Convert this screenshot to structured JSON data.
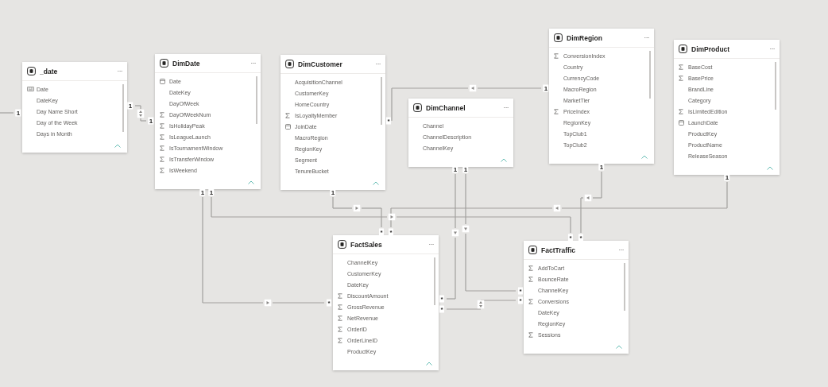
{
  "tables": [
    {
      "name": "_date",
      "scrollable": true,
      "fields": [
        {
          "name": "Date",
          "kind": "hierarchy"
        },
        {
          "name": "DateKey",
          "kind": "plain"
        },
        {
          "name": "Day Name Short",
          "kind": "plain"
        },
        {
          "name": "Day of the Week",
          "kind": "plain"
        },
        {
          "name": "Days in Month",
          "kind": "plain"
        }
      ]
    },
    {
      "name": "DimDate",
      "scrollable": true,
      "fields": [
        {
          "name": "Date",
          "kind": "date"
        },
        {
          "name": "DateKey",
          "kind": "plain"
        },
        {
          "name": "DayOfWeek",
          "kind": "plain"
        },
        {
          "name": "DayOfWeekNum",
          "kind": "sum"
        },
        {
          "name": "IsHolidayPeak",
          "kind": "sum"
        },
        {
          "name": "IsLeagueLaunch",
          "kind": "sum"
        },
        {
          "name": "IsTournamentWindow",
          "kind": "sum"
        },
        {
          "name": "IsTransferWindow",
          "kind": "sum"
        },
        {
          "name": "IsWeekend",
          "kind": "sum"
        }
      ]
    },
    {
      "name": "DimCustomer",
      "scrollable": true,
      "fields": [
        {
          "name": "AcquisitionChannel",
          "kind": "plain"
        },
        {
          "name": "CustomerKey",
          "kind": "plain"
        },
        {
          "name": "HomeCountry",
          "kind": "plain"
        },
        {
          "name": "IsLoyaltyMember",
          "kind": "sum"
        },
        {
          "name": "JoinDate",
          "kind": "date"
        },
        {
          "name": "MacroRegion",
          "kind": "plain"
        },
        {
          "name": "RegionKey",
          "kind": "plain"
        },
        {
          "name": "Segment",
          "kind": "plain"
        },
        {
          "name": "TenureBucket",
          "kind": "plain"
        }
      ]
    },
    {
      "name": "DimChannel",
      "scrollable": false,
      "fields": [
        {
          "name": "Channel",
          "kind": "plain"
        },
        {
          "name": "ChannelDescription",
          "kind": "plain"
        },
        {
          "name": "ChannelKey",
          "kind": "plain"
        }
      ]
    },
    {
      "name": "DimRegion",
      "scrollable": true,
      "fields": [
        {
          "name": "ConversionIndex",
          "kind": "sum"
        },
        {
          "name": "Country",
          "kind": "plain"
        },
        {
          "name": "CurrencyCode",
          "kind": "plain"
        },
        {
          "name": "MacroRegion",
          "kind": "plain"
        },
        {
          "name": "MarketTier",
          "kind": "plain"
        },
        {
          "name": "PriceIndex",
          "kind": "sum"
        },
        {
          "name": "RegionKey",
          "kind": "plain"
        },
        {
          "name": "TopClub1",
          "kind": "plain"
        },
        {
          "name": "TopClub2",
          "kind": "plain"
        }
      ]
    },
    {
      "name": "DimProduct",
      "scrollable": true,
      "fields": [
        {
          "name": "BaseCost",
          "kind": "sum"
        },
        {
          "name": "BasePrice",
          "kind": "sum"
        },
        {
          "name": "BrandLine",
          "kind": "plain"
        },
        {
          "name": "Category",
          "kind": "plain"
        },
        {
          "name": "IsLimitedEdition",
          "kind": "sum"
        },
        {
          "name": "LaunchDate",
          "kind": "date"
        },
        {
          "name": "ProductKey",
          "kind": "plain"
        },
        {
          "name": "ProductName",
          "kind": "plain"
        },
        {
          "name": "ReleaseSeason",
          "kind": "plain"
        }
      ]
    },
    {
      "name": "FactSales",
      "scrollable": true,
      "fields": [
        {
          "name": "ChannelKey",
          "kind": "plain"
        },
        {
          "name": "CustomerKey",
          "kind": "plain"
        },
        {
          "name": "DateKey",
          "kind": "plain"
        },
        {
          "name": "DiscountAmount",
          "kind": "sum"
        },
        {
          "name": "GrossRevenue",
          "kind": "sum"
        },
        {
          "name": "NetRevenue",
          "kind": "sum"
        },
        {
          "name": "OrderID",
          "kind": "sum"
        },
        {
          "name": "OrderLineID",
          "kind": "sum"
        },
        {
          "name": "ProductKey",
          "kind": "plain"
        }
      ]
    },
    {
      "name": "FactTraffic",
      "scrollable": true,
      "fields": [
        {
          "name": "AddToCart",
          "kind": "sum"
        },
        {
          "name": "BounceRate",
          "kind": "sum"
        },
        {
          "name": "ChannelKey",
          "kind": "plain"
        },
        {
          "name": "Conversions",
          "kind": "sum"
        },
        {
          "name": "DateKey",
          "kind": "plain"
        },
        {
          "name": "RegionKey",
          "kind": "plain"
        },
        {
          "name": "Sessions",
          "kind": "sum"
        }
      ]
    }
  ],
  "menu_glyph": "···",
  "relationships": [
    {
      "ends": [
        "1"
      ]
    },
    {
      "ends": [
        "1",
        "1"
      ],
      "kind": "both"
    },
    {
      "ends": [
        "*",
        "1"
      ],
      "kind": "single"
    },
    {
      "ends": [
        "1",
        "*"
      ],
      "kind": "single"
    },
    {
      "ends": [
        "1",
        "*"
      ],
      "kind": "single"
    },
    {
      "ends": [
        "1",
        "*"
      ],
      "kind": "single"
    },
    {
      "ends": [
        "1",
        "*"
      ],
      "kind": "single"
    },
    {
      "ends": [
        "1",
        "*"
      ],
      "kind": "single"
    },
    {
      "ends": [
        "1",
        "*"
      ],
      "kind": "single"
    },
    {
      "ends": [
        "1",
        "*"
      ],
      "kind": "single"
    },
    {
      "ends": [
        "*",
        "*"
      ],
      "kind": "both"
    }
  ]
}
